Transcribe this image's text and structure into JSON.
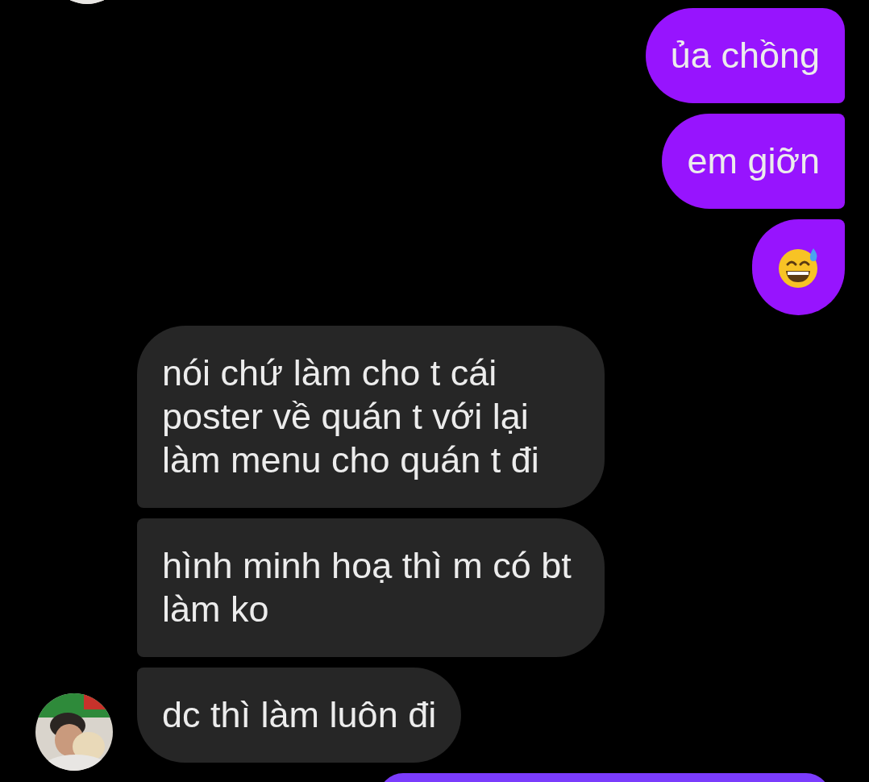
{
  "messages": [
    {
      "outgoing": true,
      "kind": "text",
      "text": "ủa chồng"
    },
    {
      "outgoing": true,
      "kind": "text",
      "text": "em giỡn"
    },
    {
      "outgoing": true,
      "kind": "emoji"
    },
    {
      "outgoing": false,
      "kind": "text",
      "text": "nói chứ làm cho t cái poster về quán t với lại làm menu cho quán t đi"
    },
    {
      "outgoing": false,
      "kind": "text",
      "text": "hình minh hoạ thì m có bt làm ko"
    },
    {
      "outgoing": false,
      "kind": "text",
      "text": "dc thì làm luôn đi"
    },
    {
      "outgoing": true,
      "kind": "partial"
    }
  ]
}
